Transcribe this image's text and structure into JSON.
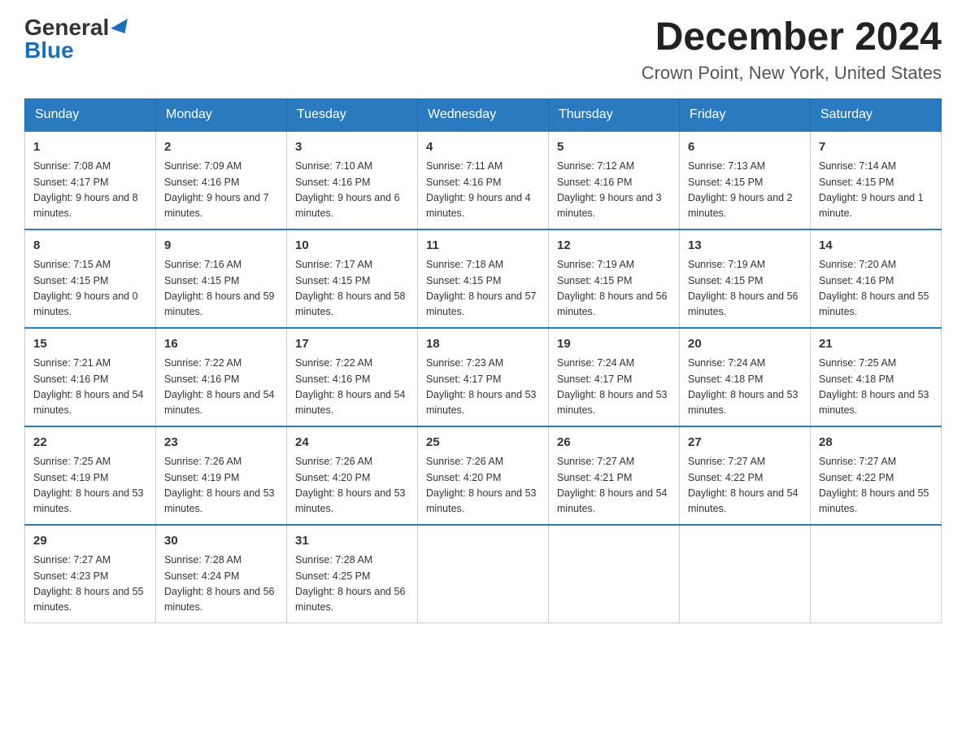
{
  "header": {
    "logo_general": "General",
    "logo_blue": "Blue",
    "month_title": "December 2024",
    "location": "Crown Point, New York, United States"
  },
  "days_of_week": [
    "Sunday",
    "Monday",
    "Tuesday",
    "Wednesday",
    "Thursday",
    "Friday",
    "Saturday"
  ],
  "weeks": [
    [
      {
        "day": "1",
        "sunrise": "7:08 AM",
        "sunset": "4:17 PM",
        "daylight": "9 hours and 8 minutes."
      },
      {
        "day": "2",
        "sunrise": "7:09 AM",
        "sunset": "4:16 PM",
        "daylight": "9 hours and 7 minutes."
      },
      {
        "day": "3",
        "sunrise": "7:10 AM",
        "sunset": "4:16 PM",
        "daylight": "9 hours and 6 minutes."
      },
      {
        "day": "4",
        "sunrise": "7:11 AM",
        "sunset": "4:16 PM",
        "daylight": "9 hours and 4 minutes."
      },
      {
        "day": "5",
        "sunrise": "7:12 AM",
        "sunset": "4:16 PM",
        "daylight": "9 hours and 3 minutes."
      },
      {
        "day": "6",
        "sunrise": "7:13 AM",
        "sunset": "4:15 PM",
        "daylight": "9 hours and 2 minutes."
      },
      {
        "day": "7",
        "sunrise": "7:14 AM",
        "sunset": "4:15 PM",
        "daylight": "9 hours and 1 minute."
      }
    ],
    [
      {
        "day": "8",
        "sunrise": "7:15 AM",
        "sunset": "4:15 PM",
        "daylight": "9 hours and 0 minutes."
      },
      {
        "day": "9",
        "sunrise": "7:16 AM",
        "sunset": "4:15 PM",
        "daylight": "8 hours and 59 minutes."
      },
      {
        "day": "10",
        "sunrise": "7:17 AM",
        "sunset": "4:15 PM",
        "daylight": "8 hours and 58 minutes."
      },
      {
        "day": "11",
        "sunrise": "7:18 AM",
        "sunset": "4:15 PM",
        "daylight": "8 hours and 57 minutes."
      },
      {
        "day": "12",
        "sunrise": "7:19 AM",
        "sunset": "4:15 PM",
        "daylight": "8 hours and 56 minutes."
      },
      {
        "day": "13",
        "sunrise": "7:19 AM",
        "sunset": "4:15 PM",
        "daylight": "8 hours and 56 minutes."
      },
      {
        "day": "14",
        "sunrise": "7:20 AM",
        "sunset": "4:16 PM",
        "daylight": "8 hours and 55 minutes."
      }
    ],
    [
      {
        "day": "15",
        "sunrise": "7:21 AM",
        "sunset": "4:16 PM",
        "daylight": "8 hours and 54 minutes."
      },
      {
        "day": "16",
        "sunrise": "7:22 AM",
        "sunset": "4:16 PM",
        "daylight": "8 hours and 54 minutes."
      },
      {
        "day": "17",
        "sunrise": "7:22 AM",
        "sunset": "4:16 PM",
        "daylight": "8 hours and 54 minutes."
      },
      {
        "day": "18",
        "sunrise": "7:23 AM",
        "sunset": "4:17 PM",
        "daylight": "8 hours and 53 minutes."
      },
      {
        "day": "19",
        "sunrise": "7:24 AM",
        "sunset": "4:17 PM",
        "daylight": "8 hours and 53 minutes."
      },
      {
        "day": "20",
        "sunrise": "7:24 AM",
        "sunset": "4:18 PM",
        "daylight": "8 hours and 53 minutes."
      },
      {
        "day": "21",
        "sunrise": "7:25 AM",
        "sunset": "4:18 PM",
        "daylight": "8 hours and 53 minutes."
      }
    ],
    [
      {
        "day": "22",
        "sunrise": "7:25 AM",
        "sunset": "4:19 PM",
        "daylight": "8 hours and 53 minutes."
      },
      {
        "day": "23",
        "sunrise": "7:26 AM",
        "sunset": "4:19 PM",
        "daylight": "8 hours and 53 minutes."
      },
      {
        "day": "24",
        "sunrise": "7:26 AM",
        "sunset": "4:20 PM",
        "daylight": "8 hours and 53 minutes."
      },
      {
        "day": "25",
        "sunrise": "7:26 AM",
        "sunset": "4:20 PM",
        "daylight": "8 hours and 53 minutes."
      },
      {
        "day": "26",
        "sunrise": "7:27 AM",
        "sunset": "4:21 PM",
        "daylight": "8 hours and 54 minutes."
      },
      {
        "day": "27",
        "sunrise": "7:27 AM",
        "sunset": "4:22 PM",
        "daylight": "8 hours and 54 minutes."
      },
      {
        "day": "28",
        "sunrise": "7:27 AM",
        "sunset": "4:22 PM",
        "daylight": "8 hours and 55 minutes."
      }
    ],
    [
      {
        "day": "29",
        "sunrise": "7:27 AM",
        "sunset": "4:23 PM",
        "daylight": "8 hours and 55 minutes."
      },
      {
        "day": "30",
        "sunrise": "7:28 AM",
        "sunset": "4:24 PM",
        "daylight": "8 hours and 56 minutes."
      },
      {
        "day": "31",
        "sunrise": "7:28 AM",
        "sunset": "4:25 PM",
        "daylight": "8 hours and 56 minutes."
      },
      null,
      null,
      null,
      null
    ]
  ]
}
